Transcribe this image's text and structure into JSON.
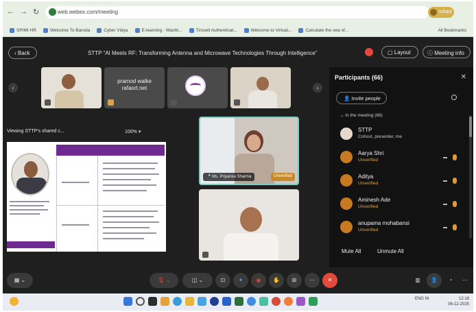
{
  "browser": {
    "url": "web.webex.com/meeting",
    "profile_label": "Ishani",
    "bookmarks": [
      "SPIMI HR",
      "Welcome To Baroda",
      "Cyber Vidya",
      "E-learning - Washt...",
      "Tirosell Authenticat...",
      "Welcome to Virtual...",
      "Calculate the sea of...",
      "All Bookmarks"
    ]
  },
  "meeting": {
    "back_label": "Back",
    "title": "STTP “AI Meets RF: Transforming Antenna and Microwave Technologies Through Intelligence”",
    "layout_label": "Layout",
    "info_label": "Meeting info"
  },
  "strip": {
    "tile2_name_line1": "pramod walke",
    "tile2_name_line2": "rafaort.net"
  },
  "share": {
    "caption": "Viewing STTP's shared c...",
    "zoom": "100%"
  },
  "grid": {
    "speaker_name": "Ms. Priyanka Sharma",
    "unverified": "Unverified"
  },
  "participants": {
    "title": "Participants (66)",
    "invite_label": "Invite people",
    "section_label": "In the meeting (66)",
    "list": [
      {
        "name": "STTP",
        "sub": "Cohost, presenter, me"
      },
      {
        "name": "Aarya Shri",
        "sub": "Unverified"
      },
      {
        "name": "Aditya",
        "sub": "Unverified"
      },
      {
        "name": "Aminesh Ade",
        "sub": "Unverified"
      },
      {
        "name": "anupama mohabansi",
        "sub": "Unverified"
      }
    ],
    "mute_all": "Mute All",
    "unmute_all": "Unmute All"
  },
  "taskbar": {
    "lang": "ENG\nIN",
    "time": "12:18",
    "date": "06-12-2025"
  },
  "colors": {
    "accent_purple": "#6f2a92",
    "leave_red": "#e34a3b",
    "unverified_orange": "#e0a540",
    "speaker_border": "#7bd0c6"
  }
}
